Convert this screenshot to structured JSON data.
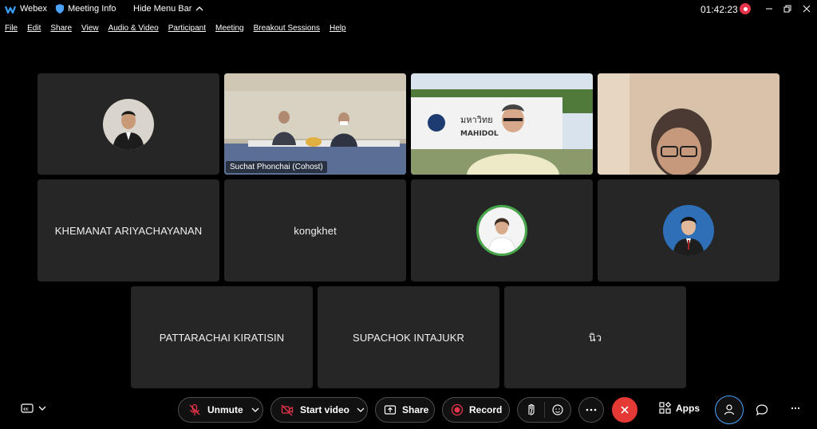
{
  "titlebar": {
    "app_name": "Webex",
    "meeting_info": "Meeting Info",
    "hide_menu": "Hide Menu Bar",
    "time": "01:42:23"
  },
  "menu": [
    "File",
    "Edit",
    "Share",
    "View",
    "Audio & Video",
    "Participant",
    "Meeting",
    "Breakout Sessions",
    "Help"
  ],
  "tiles": {
    "t1_video_label": "Suchat Phonchai (Cohost)",
    "t2_sign_text": "มหาวิทย",
    "t2_sign_text2": "MAHIDOL",
    "n1": "KHEMANAT ARIYACHAYANAN",
    "n2": "kongkhet",
    "n3": "PATTARACHAI KIRATISIN",
    "n4": "SUPACHOK INTAJUKR",
    "n5": "นิว"
  },
  "toolbar": {
    "unmute": "Unmute",
    "start_video": "Start video",
    "share": "Share",
    "record": "Record",
    "apps": "Apps"
  },
  "colors": {
    "tile_bg": "#262626",
    "active_speaker": "#4aa3ff",
    "leave_red": "#e53935",
    "recording_red": "#e5344a"
  }
}
